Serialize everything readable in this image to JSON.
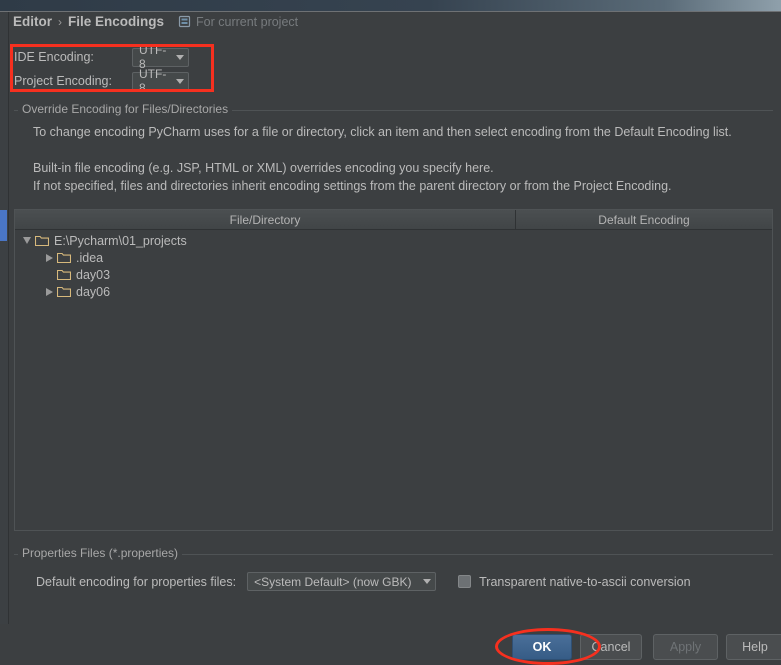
{
  "window": {
    "titlebar_present": true
  },
  "breadcrumb": {
    "parent": "Editor",
    "separator": "›",
    "current": "File Encodings",
    "scope_icon": "module-settings-icon",
    "scope_label": "For current project"
  },
  "encoding": {
    "ide_label": "IDE Encoding:",
    "ide_value": "UTF-8",
    "project_label": "Project Encoding:",
    "project_value": "UTF-8"
  },
  "override_group": {
    "title": "Override Encoding for Files/Directories",
    "line1": "To change encoding PyCharm uses for a file or directory, click an item and then select encoding from the Default Encoding list.",
    "line2": "Built-in file encoding (e.g. JSP, HTML or XML) overrides encoding you specify here.",
    "line3": "If not specified, files and directories inherit encoding settings from the parent directory or from the Project Encoding."
  },
  "table": {
    "headers": [
      "File/Directory",
      "Default Encoding"
    ],
    "rows": [
      {
        "label": "E:\\Pycharm\\01_projects",
        "level": 0,
        "expander": "down",
        "icon": "folder-icon",
        "encoding": ""
      },
      {
        "label": ".idea",
        "level": 1,
        "expander": "right",
        "icon": "folder-icon",
        "encoding": ""
      },
      {
        "label": "day03",
        "level": 1,
        "expander": "none",
        "icon": "folder-icon",
        "encoding": ""
      },
      {
        "label": "day06",
        "level": 1,
        "expander": "right",
        "icon": "folder-icon",
        "encoding": ""
      }
    ]
  },
  "properties_group": {
    "title": "Properties Files (*.properties)",
    "default_encoding_label": "Default encoding for properties files:",
    "default_encoding_value": "<System Default> (now GBK)",
    "checkbox_label": "Transparent native-to-ascii conversion",
    "checkbox_checked": false
  },
  "buttons": {
    "ok": "OK",
    "cancel": "Cancel",
    "apply": "Apply",
    "help": "Help",
    "apply_enabled": false
  },
  "annotations": {
    "rect_color": "#f6301f",
    "ellipse_color": "#f6301f"
  },
  "colors": {
    "background": "#3c3f41",
    "text": "#bbbbbb",
    "accent_blue": "#4a76c6",
    "folder_gold": "#d7b97c",
    "ok_button": "#3d6490"
  }
}
